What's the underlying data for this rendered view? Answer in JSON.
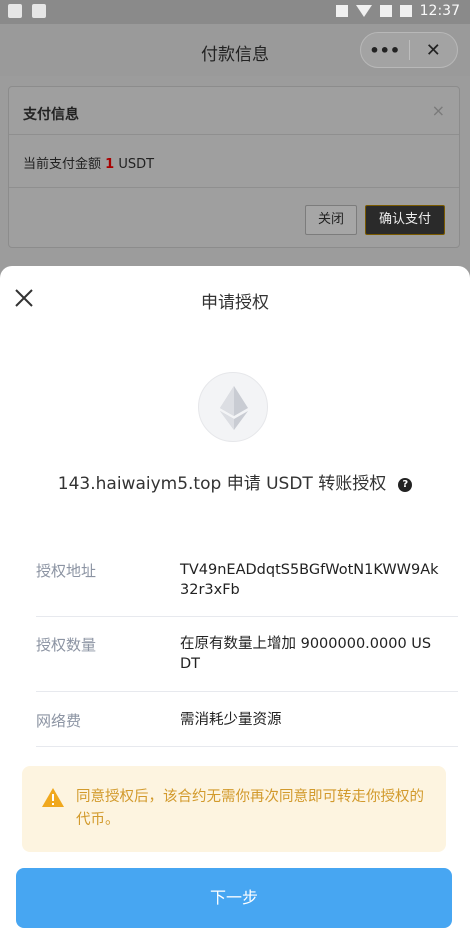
{
  "statusbar": {
    "time": "12:37"
  },
  "titlebar": {
    "title": "付款信息",
    "more_label": "•••",
    "close_label": "✕"
  },
  "pay_dialog": {
    "title": "支付信息",
    "close_label": "×",
    "amount_prefix": "当前支付金额",
    "amount_value": "1",
    "amount_unit": "USDT",
    "btn_close": "关闭",
    "btn_confirm": "确认支付"
  },
  "sheet": {
    "title": "申请授权",
    "token_icon": "ethereum-icon",
    "request_text": "143.haiwaiym5.top 申请 USDT 转账授权",
    "help_icon": "?",
    "rows": [
      {
        "label": "授权地址",
        "value": "TV49nEADdqtS5BGfWotN1KWW9Ak32r3xFb"
      },
      {
        "label": "授权数量",
        "value": "在原有数量上增加 9000000.0000 USDT"
      },
      {
        "label": "网络费",
        "value": "需消耗少量资源"
      }
    ],
    "warning_text": "同意授权后，该合约无需你再次同意即可转走你授权的代币。",
    "next_label": "下一步"
  },
  "colors": {
    "primary": "#47a6f2",
    "warning_bg": "#fdf4e0",
    "warning_text": "#d29a2c",
    "label_gray": "#8c94a3",
    "amount_red": "#a80000"
  }
}
